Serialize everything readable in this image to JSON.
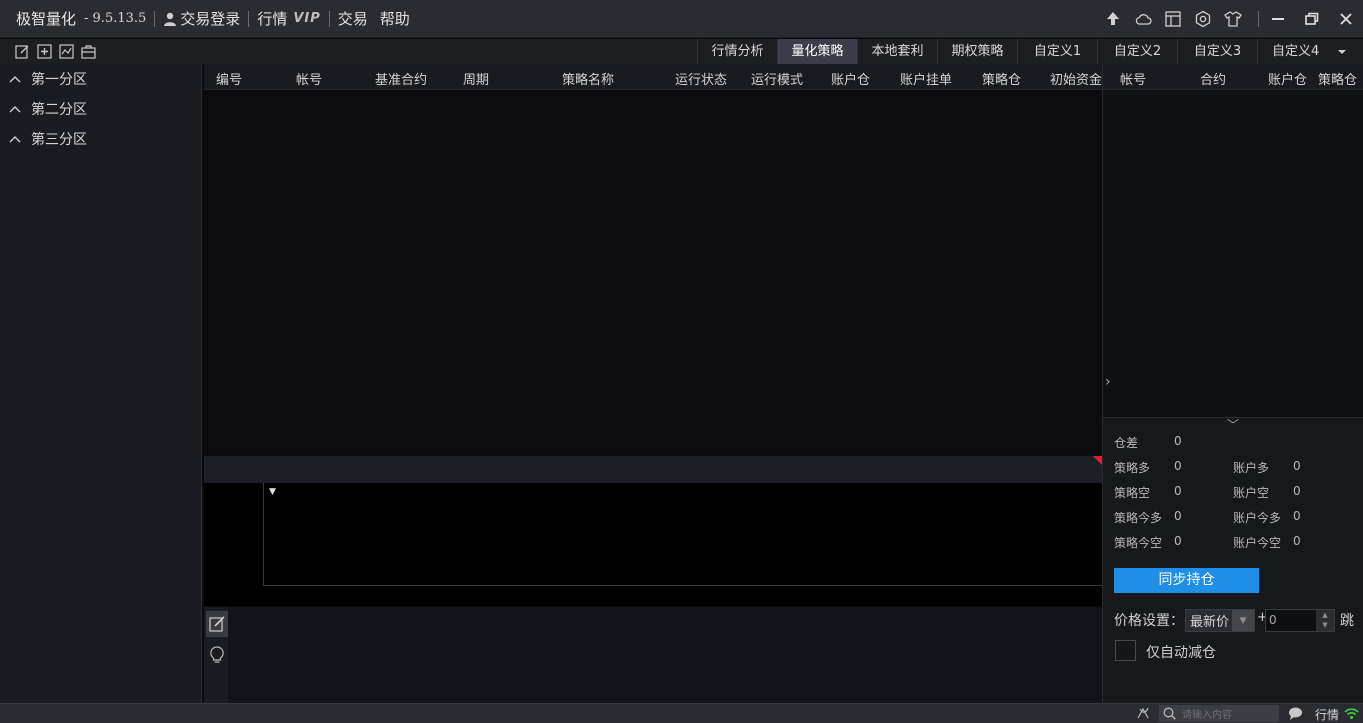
{
  "titlebar": {
    "app_title": "极智量化",
    "version": "- 9.5.13.5",
    "menu": {
      "login": "交易登录",
      "market": "行情",
      "vip": "VIP",
      "trade": "交易",
      "help": "帮助"
    },
    "icons": [
      "upload-icon",
      "cloud-icon",
      "layout-icon",
      "hexagon-settings-icon",
      "shirt-skin-icon"
    ],
    "window_controls": [
      "minimize-icon",
      "restore-icon",
      "close-icon"
    ]
  },
  "toolbar": {
    "icons": [
      "edit-icon",
      "add-icon",
      "chart-icon",
      "briefcase-icon"
    ],
    "tabs": [
      {
        "label": "行情分析",
        "active": false
      },
      {
        "label": "量化策略",
        "active": true
      },
      {
        "label": "本地套利",
        "active": false
      },
      {
        "label": "期权策略",
        "active": false
      },
      {
        "label": "自定义1",
        "active": false
      },
      {
        "label": "自定义2",
        "active": false
      },
      {
        "label": "自定义3",
        "active": false
      },
      {
        "label": "自定义4",
        "active": false
      }
    ]
  },
  "sidebar": {
    "sections": [
      "第一分区",
      "第二分区",
      "第三分区"
    ]
  },
  "strategy_table": {
    "columns": [
      "编号",
      "帐号",
      "基准合约",
      "周期",
      "策略名称",
      "运行状态",
      "运行模式",
      "账户仓",
      "账户挂单",
      "策略仓",
      "初始资金"
    ],
    "rows": []
  },
  "position_table": {
    "columns": [
      "帐号",
      "合约",
      "账户仓",
      "策略仓"
    ],
    "rows": []
  },
  "stats": {
    "diff_label": "仓差",
    "diff_value": "0",
    "left": [
      {
        "label": "策略多",
        "value": "0"
      },
      {
        "label": "策略空",
        "value": "0"
      },
      {
        "label": "策略今多",
        "value": "0"
      },
      {
        "label": "策略今空",
        "value": "0"
      }
    ],
    "right": [
      {
        "label": "账户多",
        "value": "0"
      },
      {
        "label": "账户空",
        "value": "0"
      },
      {
        "label": "账户今多",
        "value": "0"
      },
      {
        "label": "账户今空",
        "value": "0"
      }
    ]
  },
  "controls": {
    "sync_button": "同步持仓",
    "price_label": "价格设置：",
    "price_option": "最新价",
    "plus": "+",
    "tick_value": "0",
    "tick_unit": "跳",
    "auto_reduce_label": "仅自动减仓",
    "auto_reduce_checked": false
  },
  "statusbar": {
    "search_placeholder": "请输入内容",
    "market_label": "行情"
  },
  "colors": {
    "accent": "#1f8ee6",
    "active_tab": "#3b3d48",
    "alert_marker": "#e0202a",
    "signal": "#3fd14a"
  }
}
